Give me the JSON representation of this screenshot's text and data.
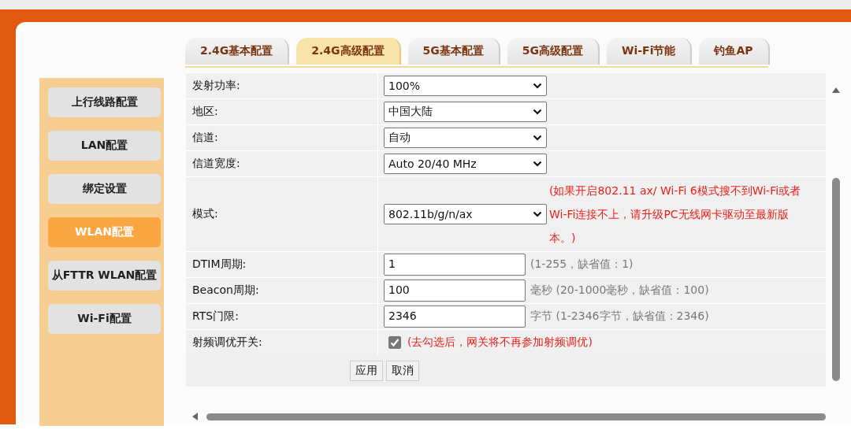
{
  "tabs": [
    {
      "label": "2.4G基本配置",
      "selected": false
    },
    {
      "label": "2.4G高级配置",
      "selected": true
    },
    {
      "label": "5G基本配置",
      "selected": false
    },
    {
      "label": "5G高级配置",
      "selected": false
    },
    {
      "label": "Wi-Fi节能",
      "selected": false
    },
    {
      "label": "钓鱼AP",
      "selected": false
    }
  ],
  "sidebar": {
    "items": [
      {
        "label": "上行线路配置",
        "selected": false
      },
      {
        "label": "LAN配置",
        "selected": false
      },
      {
        "label": "绑定设置",
        "selected": false
      },
      {
        "label": "WLAN配置",
        "selected": true
      },
      {
        "label": "从FTTR WLAN配置",
        "selected": false
      },
      {
        "label": "Wi-Fi配置",
        "selected": false
      }
    ]
  },
  "form": {
    "rows": [
      {
        "kind": "select",
        "label": "发射功率:",
        "value": "100%"
      },
      {
        "kind": "select",
        "label": "地区:",
        "value": "中国大陆"
      },
      {
        "kind": "select",
        "label": "信道:",
        "value": "自动"
      },
      {
        "kind": "select",
        "label": "信道宽度:",
        "value": "Auto 20/40 MHz"
      },
      {
        "kind": "select",
        "label": "模式:",
        "value": "802.11b/g/n/ax",
        "note": "(如果开启802.11 ax/ Wi-Fi 6模式搜不到Wi-Fi或者Wi-Fi连接不上，请升级PC无线网卡驱动至最新版本。)"
      },
      {
        "kind": "input",
        "label": "DTIM周期:",
        "value": "1",
        "hint": "(1-255，缺省值：1)"
      },
      {
        "kind": "input",
        "label": "Beacon周期:",
        "value": "100",
        "hint": "毫秒 (20-1000毫秒，缺省值：100)"
      },
      {
        "kind": "input",
        "label": "RTS门限:",
        "value": "2346",
        "hint": "字节 (1-2346字节，缺省值：2346)"
      },
      {
        "kind": "checkbox",
        "label": "射频调优开关:",
        "checked": true,
        "note": "(去勾选后，网关将不再参加射频调优)"
      }
    ],
    "buttons": [
      "应用",
      "取消"
    ]
  }
}
